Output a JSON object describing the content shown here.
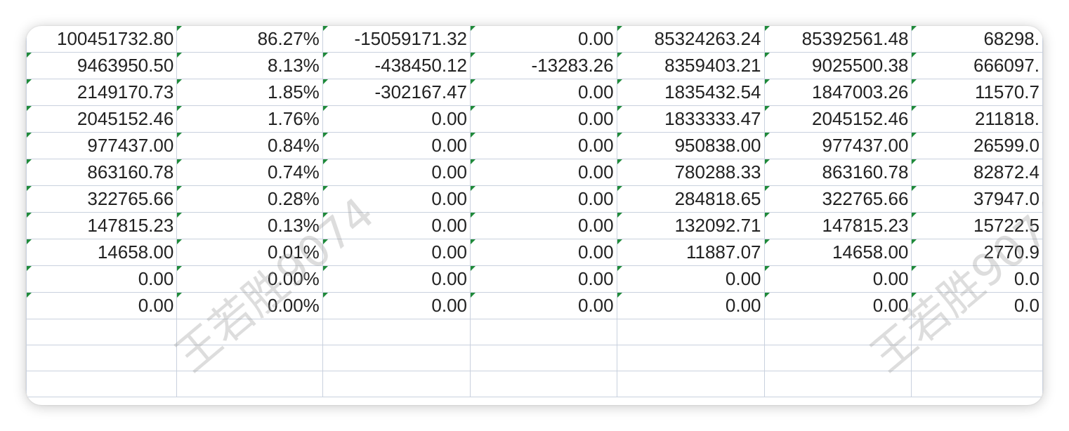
{
  "sheet": {
    "rows": [
      [
        "100451732.80",
        "86.27%",
        "-15059171.32",
        "0.00",
        "85324263.24",
        "85392561.48",
        "68298."
      ],
      [
        "9463950.50",
        "8.13%",
        "-438450.12",
        "-13283.26",
        "8359403.21",
        "9025500.38",
        "666097."
      ],
      [
        "2149170.73",
        "1.85%",
        "-302167.47",
        "0.00",
        "1835432.54",
        "1847003.26",
        "11570.7"
      ],
      [
        "2045152.46",
        "1.76%",
        "0.00",
        "0.00",
        "1833333.47",
        "2045152.46",
        "211818."
      ],
      [
        "977437.00",
        "0.84%",
        "0.00",
        "0.00",
        "950838.00",
        "977437.00",
        "26599.0"
      ],
      [
        "863160.78",
        "0.74%",
        "0.00",
        "0.00",
        "780288.33",
        "863160.78",
        "82872.4"
      ],
      [
        "322765.66",
        "0.28%",
        "0.00",
        "0.00",
        "284818.65",
        "322765.66",
        "37947.0"
      ],
      [
        "147815.23",
        "0.13%",
        "0.00",
        "0.00",
        "132092.71",
        "147815.23",
        "15722.5"
      ],
      [
        "14658.00",
        "0.01%",
        "0.00",
        "0.00",
        "11887.07",
        "14658.00",
        "2770.9"
      ],
      [
        "0.00",
        "0.00%",
        "0.00",
        "0.00",
        "0.00",
        "0.00",
        "0.0"
      ],
      [
        "0.00",
        "0.00%",
        "0.00",
        "0.00",
        "0.00",
        "0.00",
        "0.0"
      ],
      [
        "",
        "",
        "",
        "",
        "",
        "",
        ""
      ],
      [
        "",
        "",
        "",
        "",
        "",
        "",
        ""
      ],
      [
        "",
        "",
        "",
        "",
        "",
        "",
        ""
      ]
    ],
    "triangle_rows": 11,
    "watermark_text": "王若胜9074",
    "colors": {
      "grid_line": "#c9d1de",
      "triangle": "#1f8a3a",
      "text": "#222222"
    }
  }
}
